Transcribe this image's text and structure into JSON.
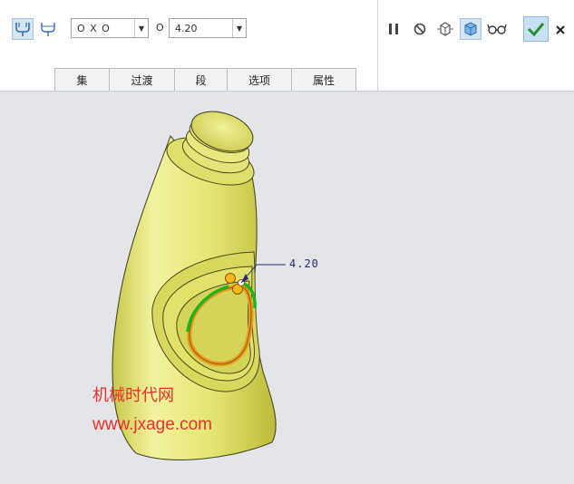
{
  "toolbar": {
    "mode_select_value": "O X O",
    "radius_prefix": "O",
    "radius_value": "4.20",
    "tabs": [
      {
        "label": "集"
      },
      {
        "label": "过渡"
      },
      {
        "label": "段"
      },
      {
        "label": "选项"
      },
      {
        "label": "属性"
      }
    ],
    "icons": {
      "fillet_mode_1": "round-set-icon",
      "fillet_mode_2": "round-transition-icon",
      "pause": "pause-icon",
      "cancel_preview": "no-preview-icon",
      "preview_geometry": "preview-geometry-icon",
      "verify": "verify-mode-icon",
      "glasses": "glasses-preview-icon",
      "apply": "checkmark-icon",
      "close": "close-icon"
    },
    "accent_color": "#2a8f2a"
  },
  "viewport": {
    "dimension_label": "4.20",
    "model_color": "#e7e77a",
    "highlight_color": "#e89a1a",
    "edge_select_color": "#1fb41f"
  },
  "watermark": {
    "line1": "机械时代网",
    "line2": "www.jxage.com"
  }
}
